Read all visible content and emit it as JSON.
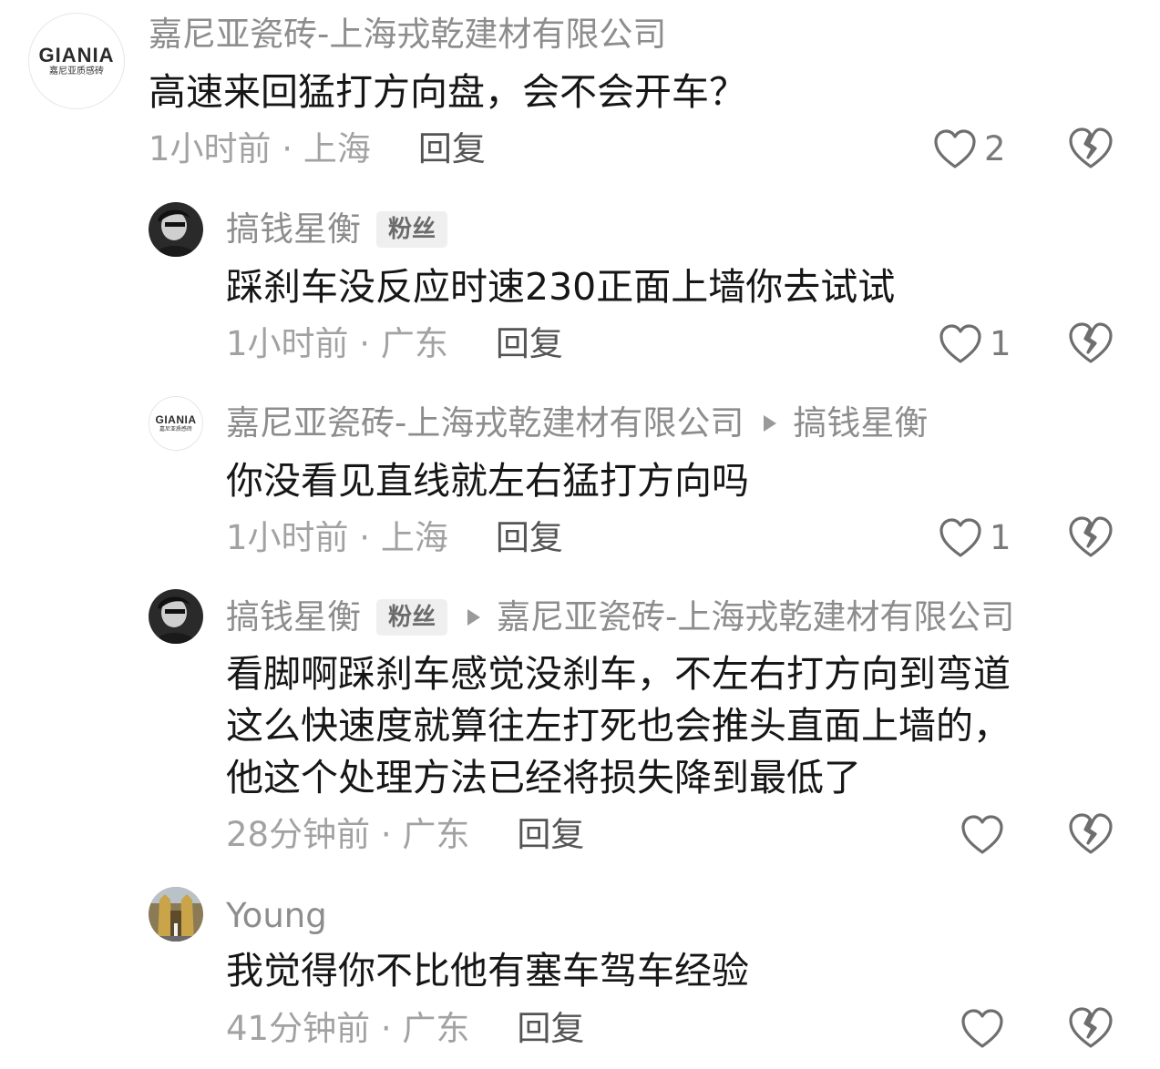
{
  "comments": [
    {
      "author": "嘉尼亚瓷砖-上海戎乾建材有限公司",
      "avatar": {
        "type": "logo",
        "logo_text": "GIANIA",
        "logo_sub": "嘉尼亚质感砖"
      },
      "text": [
        "高速来回猛打方向盘，会不会开车？"
      ],
      "time_location": "1小时前 · 上海",
      "reply_label": "回复",
      "likes": "2"
    },
    {
      "author": "搞钱星衡",
      "badge": "粉丝",
      "avatar": {
        "type": "photo"
      },
      "text": [
        "踩刹车没反应时速230正面上墙你去试试"
      ],
      "time_location": "1小时前 · 广东",
      "reply_label": "回复",
      "likes": "1"
    },
    {
      "author": "嘉尼亚瓷砖-上海戎乾建材有限公司",
      "reply_to": "搞钱星衡",
      "avatar": {
        "type": "logo",
        "logo_text": "GIANIA",
        "logo_sub": "嘉尼亚质感砖"
      },
      "text": [
        "你没看见直线就左右猛打方向吗"
      ],
      "time_location": "1小时前 · 上海",
      "reply_label": "回复",
      "likes": "1"
    },
    {
      "author": "搞钱星衡",
      "badge": "粉丝",
      "reply_to": "嘉尼亚瓷砖-上海戎乾建材有限公司",
      "avatar": {
        "type": "photo"
      },
      "text": [
        "看脚啊踩刹车感觉没刹车，不左右打方向到弯道",
        "这么快速度就算往左打死也会推头直面上墙的，",
        "他这个处理方法已经将损失降到最低了"
      ],
      "time_location": "28分钟前 · 广东",
      "reply_label": "回复",
      "likes": ""
    },
    {
      "author": "Young",
      "avatar": {
        "type": "photo-temple"
      },
      "text": [
        "我觉得你不比他有塞车驾车经验"
      ],
      "time_location": "41分钟前 · 广东",
      "reply_label": "回复",
      "likes": ""
    }
  ],
  "icons": {
    "like": "heart-outline-icon",
    "dislike": "broken-heart-icon",
    "reply_arrow": "play-triangle-icon"
  },
  "colors": {
    "text_primary": "#161616",
    "text_secondary": "#8d8d8d",
    "meta": "#a2a2a2",
    "reply_button": "#545454",
    "badge_bg": "#efefef",
    "icon_stroke": "#6e6e6e"
  }
}
